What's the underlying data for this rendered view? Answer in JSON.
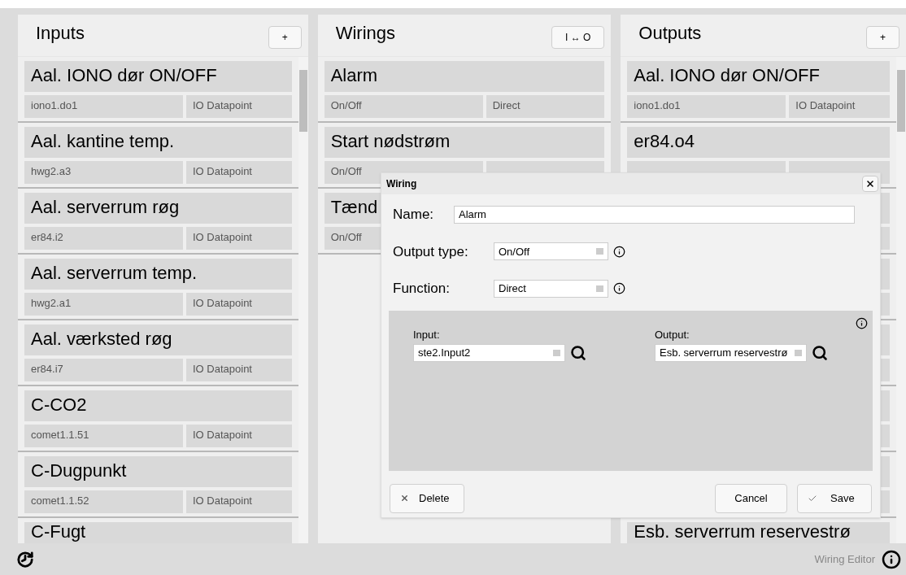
{
  "panels": [
    {
      "title": "Inputs",
      "button": "+",
      "scrollbar": true,
      "items": [
        {
          "title": "Aal. IONO dør ON/OFF",
          "sub": [
            "iono1.do1",
            "IO Datapoint"
          ]
        },
        {
          "title": "Aal. kantine temp.",
          "sub": [
            "hwg2.a3",
            "IO Datapoint"
          ]
        },
        {
          "title": "Aal. serverrum røg",
          "sub": [
            "er84.i2",
            "IO Datapoint"
          ]
        },
        {
          "title": "Aal. serverrum temp.",
          "sub": [
            "hwg2.a1",
            "IO Datapoint"
          ]
        },
        {
          "title": "Aal. værksted røg",
          "sub": [
            "er84.i7",
            "IO Datapoint"
          ]
        },
        {
          "title": "C-CO2",
          "sub": [
            "comet1.1.51",
            "IO Datapoint"
          ]
        },
        {
          "title": "C-Dugpunkt",
          "sub": [
            "comet1.1.52",
            "IO Datapoint"
          ]
        },
        {
          "title": "C-Fugt",
          "kind": "cut"
        }
      ]
    },
    {
      "title": "Wirings",
      "button": "I ↔ O",
      "scrollbar": false,
      "items": [
        {
          "title": "Alarm",
          "sub": [
            "On/Off",
            "Direct"
          ]
        },
        {
          "title": "Start nødstrøm",
          "sub": [
            "On/Off"
          ]
        },
        {
          "title": "Tænd",
          "sub": [
            "On/Off"
          ]
        }
      ]
    },
    {
      "title": "Outputs",
      "button": "+",
      "scrollbar": true,
      "items": [
        {
          "title": "Aal. IONO dør ON/OFF",
          "sub": [
            "iono1.do1",
            "IO Datapoint"
          ]
        },
        {
          "title": "er84.o4"
        },
        {
          "kind": "covered"
        },
        {
          "kind": "covered"
        },
        {
          "kind": "covered"
        },
        {
          "kind": "covered"
        },
        {
          "kind": "covered"
        },
        {
          "title": "Esb. serverrum reservestrø",
          "kind": "cut"
        }
      ]
    }
  ],
  "dialog": {
    "title": "Wiring",
    "name_label": "Name:",
    "name_value": "Alarm",
    "output_type_label": "Output type:",
    "output_type_value": "On/Off",
    "function_label": "Function:",
    "function_value": "Direct",
    "input_label": "Input:",
    "input_value": "ste2.Input2",
    "output_label": "Output:",
    "output_value": "Esb. serverrum reservestrø",
    "buttons": {
      "delete": "Delete",
      "cancel": "Cancel",
      "save": "Save"
    }
  },
  "footer": {
    "label": "Wiring Editor"
  }
}
